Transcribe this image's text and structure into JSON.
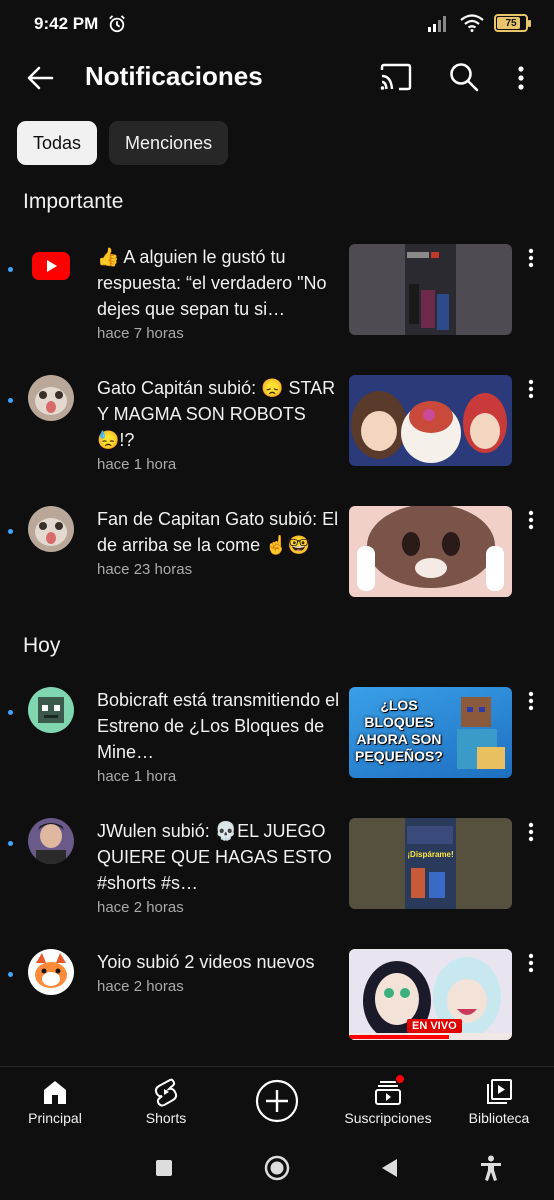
{
  "status_bar": {
    "time": "9:42 PM",
    "battery": "75",
    "battery_level": 0.75
  },
  "header": {
    "title": "Notificaciones"
  },
  "chips": [
    {
      "label": "Todas",
      "active": true
    },
    {
      "label": "Menciones",
      "active": false
    }
  ],
  "sections": [
    {
      "title": "Importante",
      "items": [
        {
          "title": "👍 A alguien le gustó tu respuesta: “el verdadero \"No dejes que sepan tu si…",
          "time": "hace 7 horas",
          "avatar": "youtube-logo",
          "thumbnail": "dark-video-still",
          "unread": true
        },
        {
          "title": "Gato Capitán subió: 😞 STAR Y MAGMA SON ROBOTS😓!?",
          "time": "hace 1 hora",
          "avatar": "cat-face",
          "thumbnail": "cartoon-characters-blue",
          "unread": true
        },
        {
          "title": "Fan de Capitan Gato subió: El de arriba se la come ☝️🤓",
          "time": "hace 23 horas",
          "avatar": "cat-face",
          "thumbnail": "cartoon-cat-hands",
          "unread": true
        }
      ]
    },
    {
      "title": "Hoy",
      "items": [
        {
          "title": "Bobicraft está transmitiendo el Estreno de ¿Los Bloques de Mine…",
          "time": "hace 1 hora",
          "avatar": "green-creature",
          "thumbnail": "minecraft-blocks",
          "thumb_text": "¿LOS BLOQUES AHORA SON PEQUEÑOS?",
          "unread": true
        },
        {
          "title": "JWulen subió: 💀EL JUEGO QUIERE QUE HAGAS ESTO #shorts #s…",
          "time": "hace 2 horas",
          "avatar": "person-photo",
          "thumbnail": "short-video-still",
          "thumb_text": "¡Dispárame!",
          "unread": true
        },
        {
          "title": "Yoio subió 2 videos nuevos",
          "time": "hace 2 horas",
          "avatar": "orange-cat-cartoon",
          "thumbnail": "anime-live",
          "thumb_text": "EN VIVO",
          "unread": true
        }
      ]
    }
  ],
  "bottom_nav": [
    {
      "label": "Principal",
      "icon": "home-icon"
    },
    {
      "label": "Shorts",
      "icon": "shorts-icon"
    },
    {
      "label": "",
      "icon": "create-plus-icon"
    },
    {
      "label": "Suscripciones",
      "icon": "subscriptions-icon",
      "badge": true
    },
    {
      "label": "Biblioteca",
      "icon": "library-icon"
    }
  ],
  "system_nav": [
    "recents-icon",
    "home-circle-icon",
    "back-triangle-icon",
    "accessibility-icon"
  ],
  "colors": {
    "background": "#0f0f0f",
    "unread_dot": "#3ea6ff",
    "youtube_red": "#ff0000",
    "battery": "#e8c56a"
  }
}
